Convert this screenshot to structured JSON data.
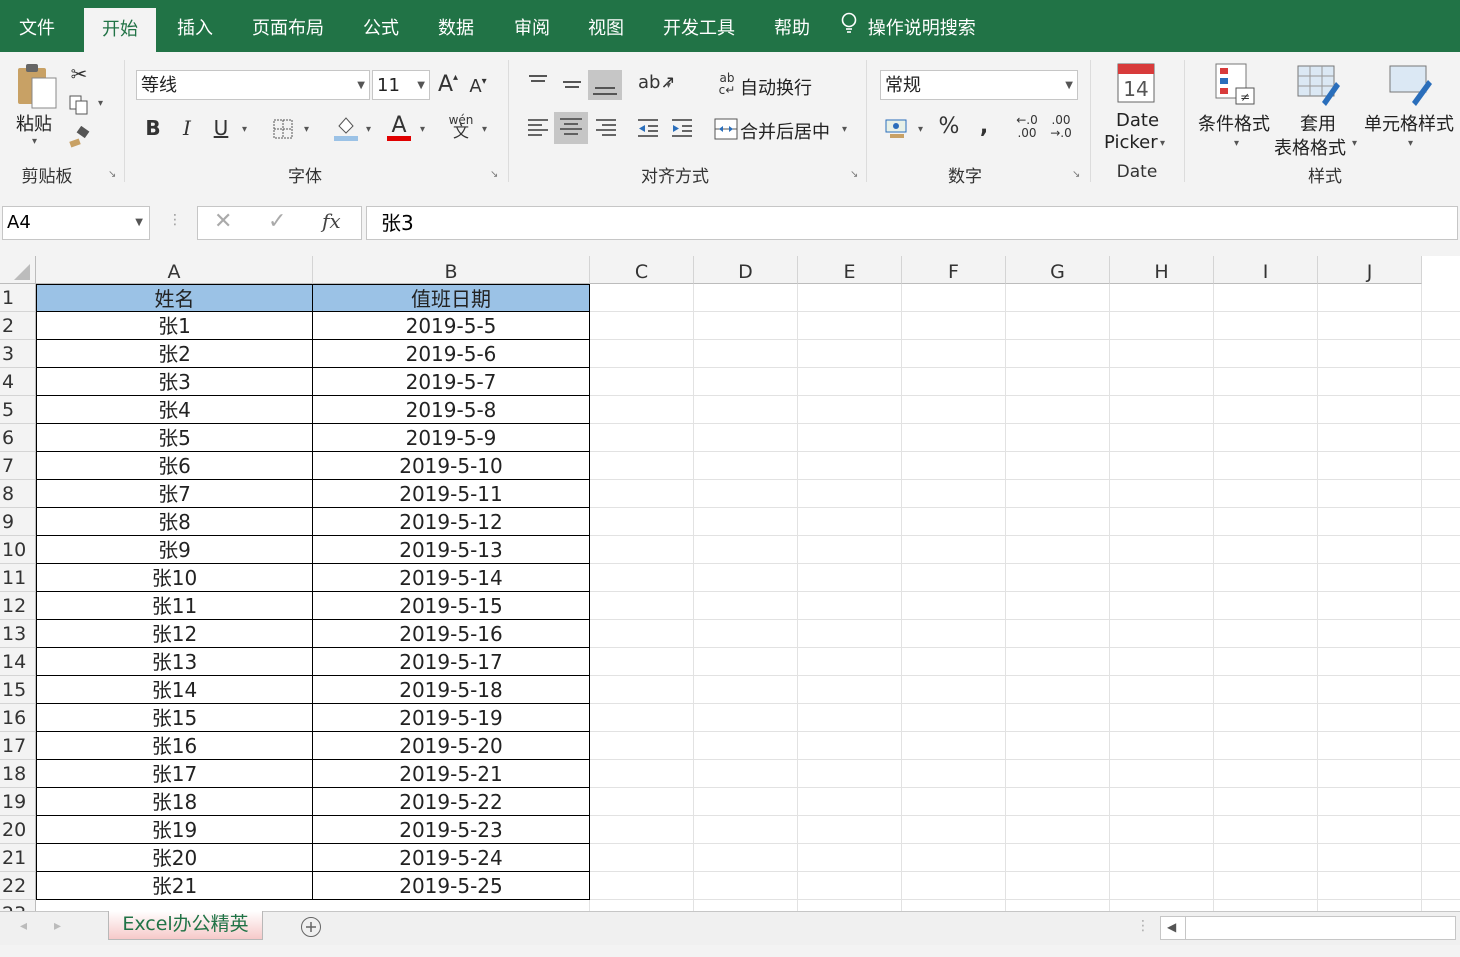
{
  "tabs": [
    "文件",
    "开始",
    "插入",
    "页面布局",
    "公式",
    "数据",
    "审阅",
    "视图",
    "开发工具",
    "帮助",
    "操作说明搜索"
  ],
  "ribbon": {
    "clipboard": {
      "paste": "粘贴",
      "label": "剪贴板"
    },
    "font": {
      "name": "等线",
      "size": "11",
      "label": "字体"
    },
    "alignment": {
      "wrap": "自动换行",
      "merge": "合并后居中",
      "label": "对齐方式"
    },
    "number": {
      "format": "常规",
      "label": "数字"
    },
    "date": {
      "icon_day": "14",
      "line1": "Date",
      "line2": "Picker",
      "label": "Date"
    },
    "styles": {
      "conditional": "条件格式",
      "table1": "套用",
      "table2": "表格格式",
      "cell": "单元格样式",
      "label": "样式"
    }
  },
  "formula_bar": {
    "name_box": "A4",
    "fx": "fx",
    "value": "张3"
  },
  "columns": [
    "A",
    "B",
    "C",
    "D",
    "E",
    "F",
    "G",
    "H",
    "I",
    "J"
  ],
  "table": {
    "headers": [
      "姓名",
      "值班日期"
    ],
    "rows": [
      [
        "张1",
        "2019-5-5"
      ],
      [
        "张2",
        "2019-5-6"
      ],
      [
        "张3",
        "2019-5-7"
      ],
      [
        "张4",
        "2019-5-8"
      ],
      [
        "张5",
        "2019-5-9"
      ],
      [
        "张6",
        "2019-5-10"
      ],
      [
        "张7",
        "2019-5-11"
      ],
      [
        "张8",
        "2019-5-12"
      ],
      [
        "张9",
        "2019-5-13"
      ],
      [
        "张10",
        "2019-5-14"
      ],
      [
        "张11",
        "2019-5-15"
      ],
      [
        "张12",
        "2019-5-16"
      ],
      [
        "张13",
        "2019-5-17"
      ],
      [
        "张14",
        "2019-5-18"
      ],
      [
        "张15",
        "2019-5-19"
      ],
      [
        "张16",
        "2019-5-20"
      ],
      [
        "张17",
        "2019-5-21"
      ],
      [
        "张18",
        "2019-5-22"
      ],
      [
        "张19",
        "2019-5-23"
      ],
      [
        "张20",
        "2019-5-24"
      ],
      [
        "张21",
        "2019-5-25"
      ]
    ]
  },
  "sheet_tab": "Excel办公精英",
  "colors": {
    "brand": "#217346",
    "header_fill": "#9bc2e6"
  }
}
